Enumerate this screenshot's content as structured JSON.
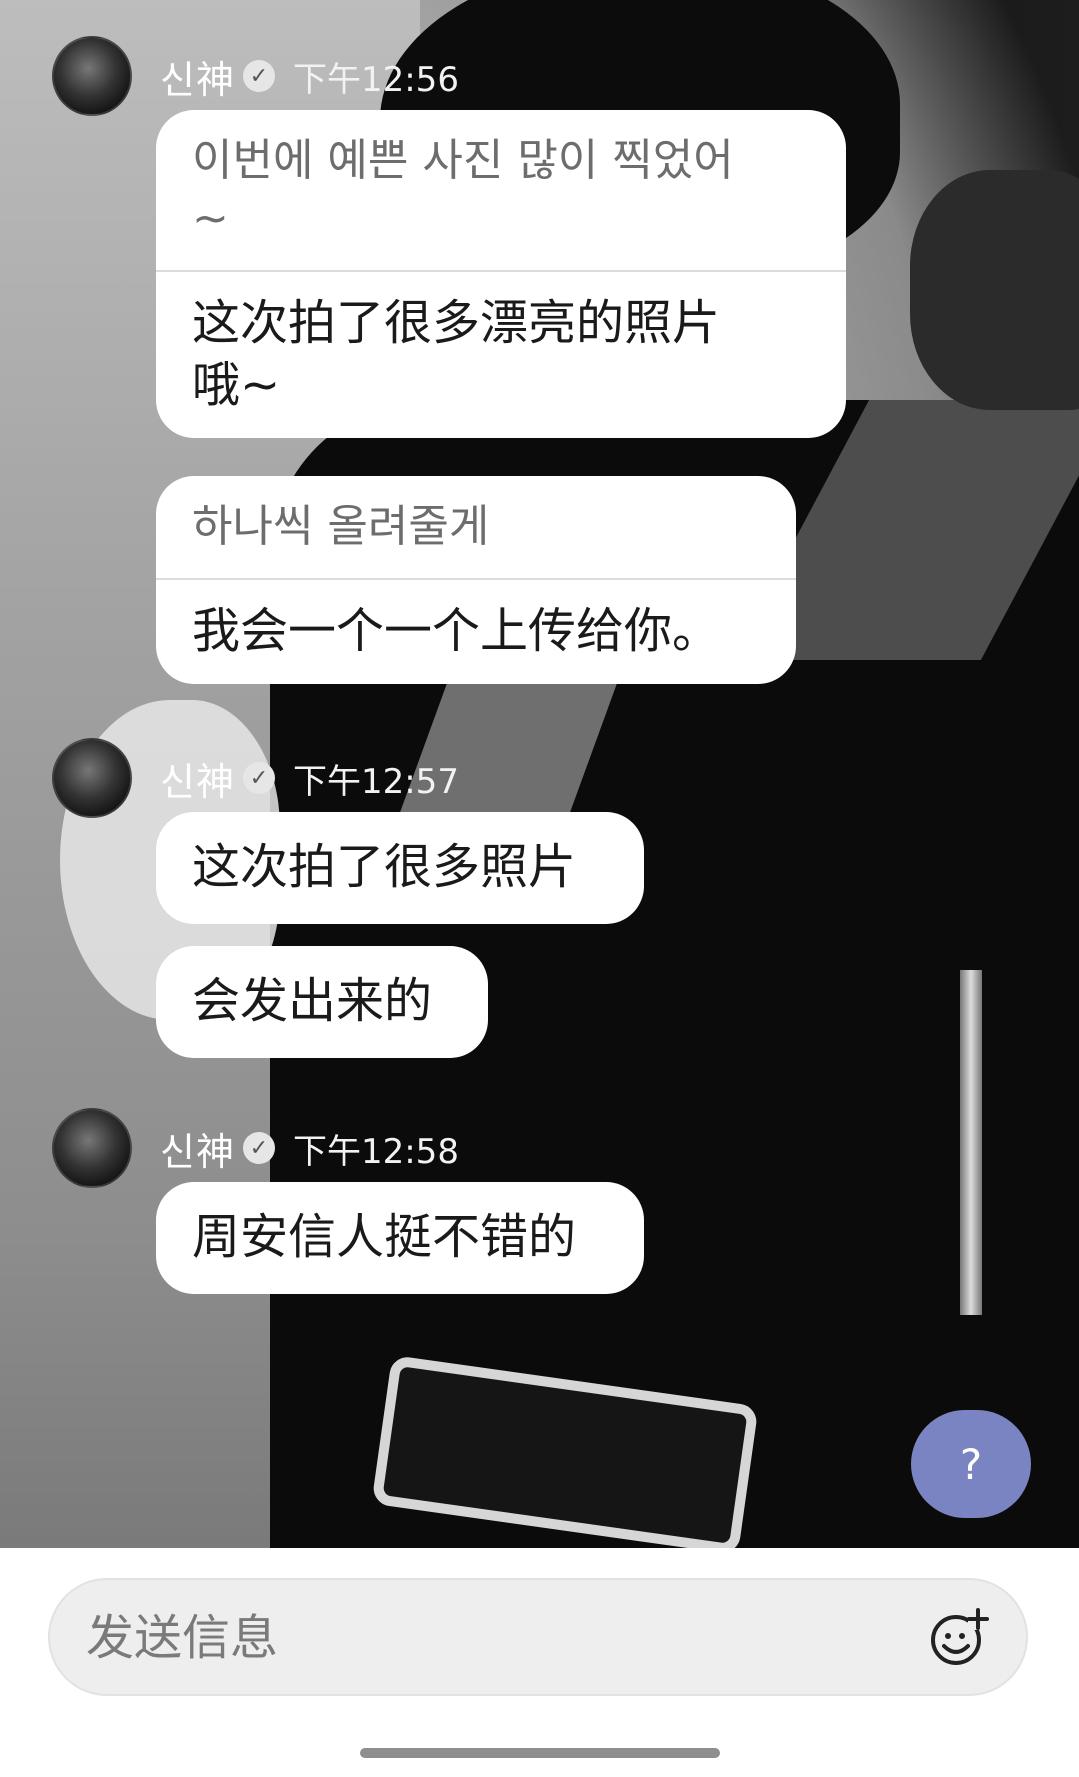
{
  "messages": [
    {
      "sender": "신神",
      "time": "下午12:56",
      "bubbles": [
        {
          "original": "이번에 예쁜 사진 많이 찍었어\n~",
          "translation": "这次拍了很多漂亮的照片\n哦~"
        },
        {
          "original": "하나씩 올려줄게",
          "translation": "我会一个一个上传给你。"
        }
      ]
    },
    {
      "sender": "신神",
      "time": "下午12:57",
      "bubbles": [
        {
          "text": "这次拍了很多照片"
        },
        {
          "text": "会发出来的"
        }
      ]
    },
    {
      "sender": "신神",
      "time": "下午12:58",
      "bubbles": [
        {
          "text": "周安信人挺不错的"
        }
      ]
    }
  ],
  "help_button": {
    "label": "?",
    "color": "#7b84c2"
  },
  "composer": {
    "placeholder": "发送信息",
    "emoji_icon": "add-emoji-icon"
  },
  "verified_icon": "verified-badge-icon"
}
